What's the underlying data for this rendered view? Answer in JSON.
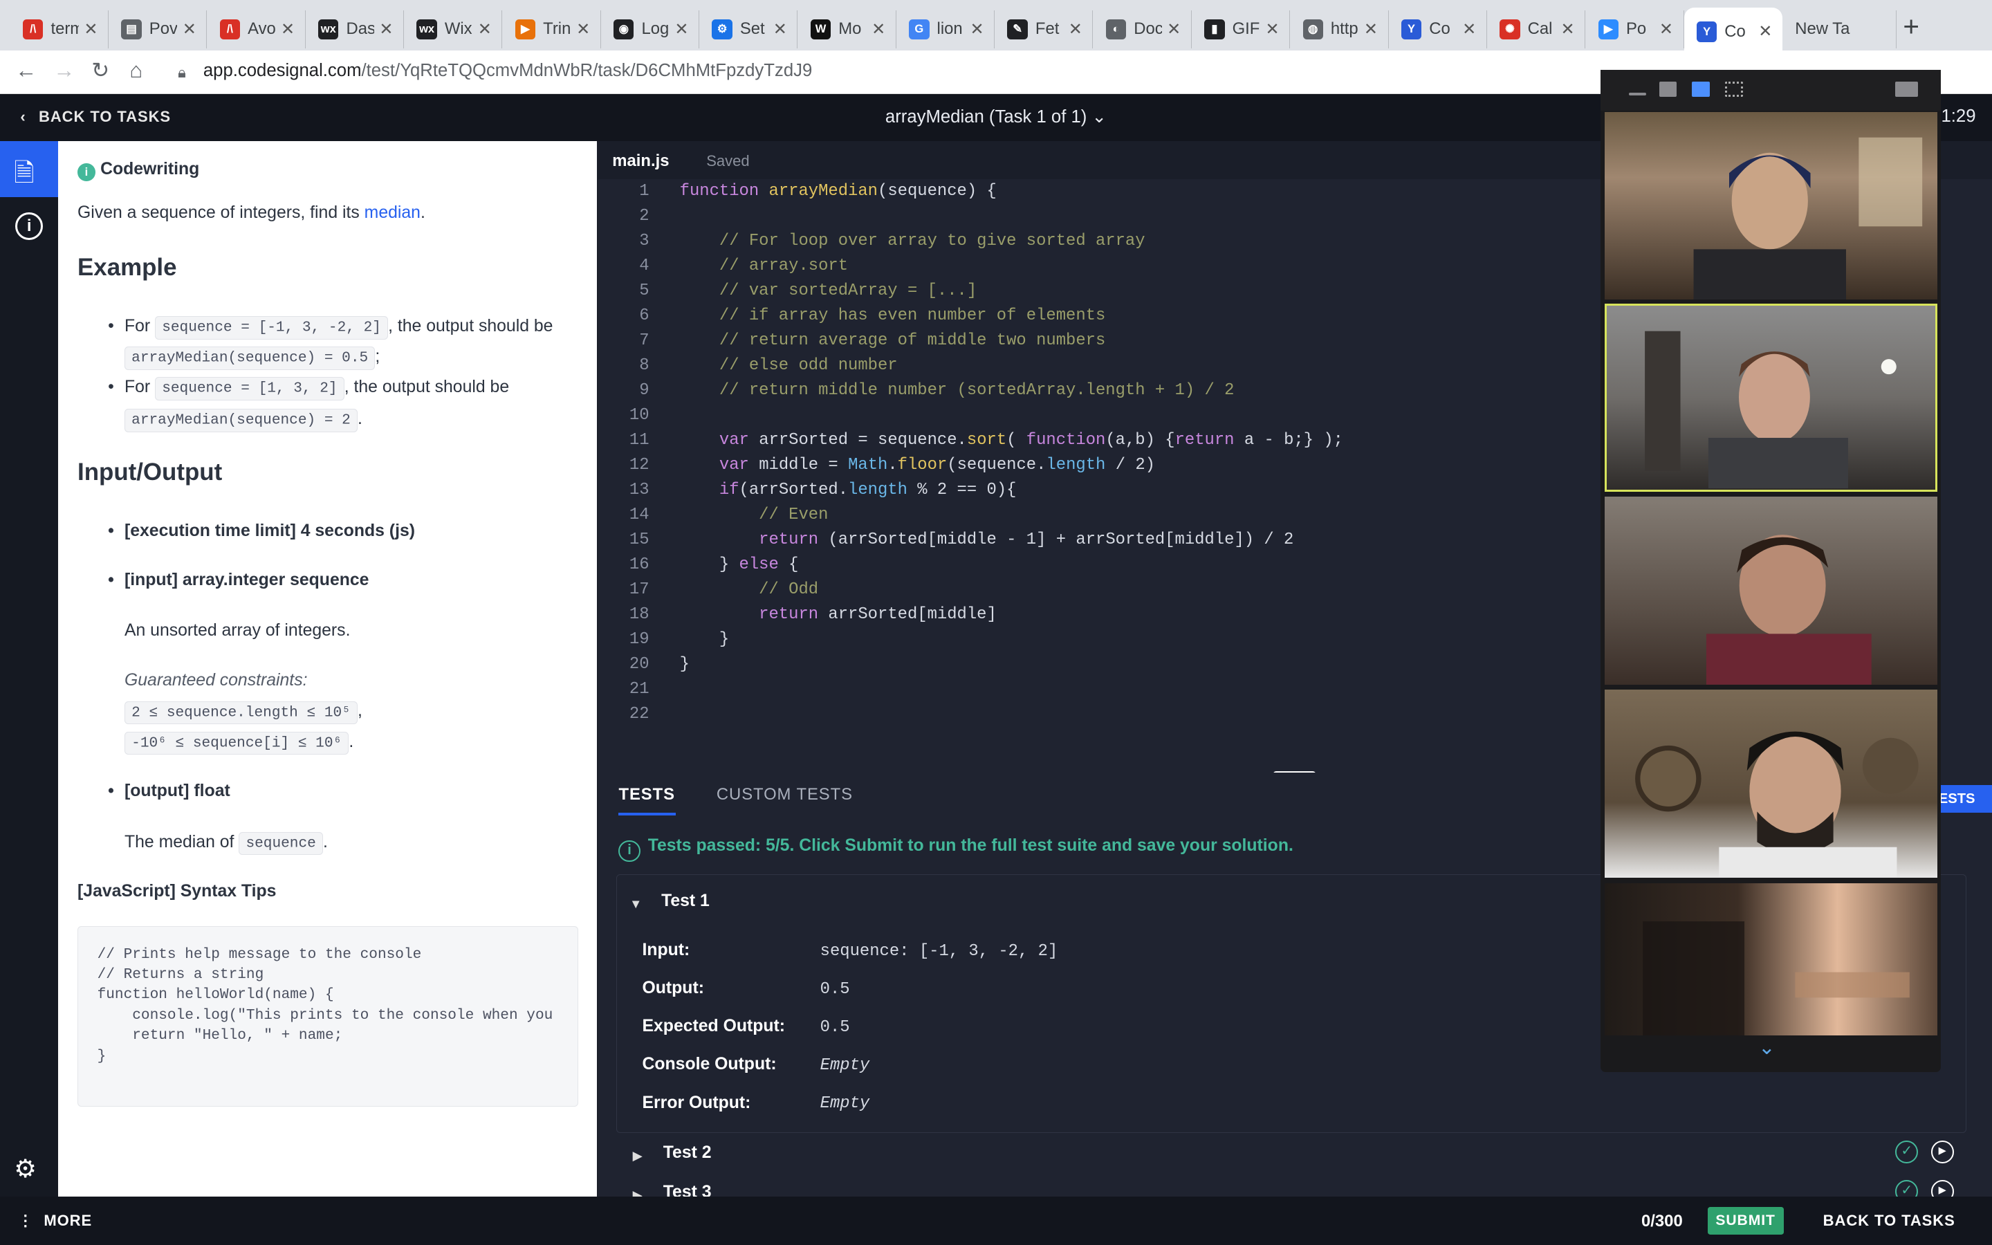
{
  "browser": {
    "tabs": [
      {
        "label": "term",
        "color": "#d93025",
        "glyph": "/\\"
      },
      {
        "label": "Pov",
        "color": "#5f6368",
        "glyph": "▤"
      },
      {
        "label": "Avo",
        "color": "#d93025",
        "glyph": "/\\"
      },
      {
        "label": "Das",
        "color": "#202124",
        "glyph": "wx"
      },
      {
        "label": "Wix",
        "color": "#202124",
        "glyph": "wx"
      },
      {
        "label": "Trin",
        "color": "#e8710a",
        "glyph": "▶"
      },
      {
        "label": "Log",
        "color": "#202124",
        "glyph": "◉"
      },
      {
        "label": "Set",
        "color": "#1a73e8",
        "glyph": "⚙"
      },
      {
        "label": "Mo",
        "color": "#111",
        "glyph": "W"
      },
      {
        "label": "lion",
        "color": "#4285f4",
        "glyph": "G"
      },
      {
        "label": "Fet",
        "color": "#202124",
        "glyph": "✎"
      },
      {
        "label": "Doc",
        "color": "#5f6368",
        "glyph": "◐"
      },
      {
        "label": "GIF",
        "color": "#202124",
        "glyph": "▮"
      },
      {
        "label": "http",
        "color": "#5f6368",
        "glyph": "◍"
      },
      {
        "label": "Co",
        "color": "#2a5bd7",
        "glyph": "Y"
      },
      {
        "label": "Cal",
        "color": "#d93025",
        "glyph": "✺"
      },
      {
        "label": "Po",
        "color": "#2d8cff",
        "glyph": "▶"
      },
      {
        "label": "Co",
        "color": "#2a5bd7",
        "glyph": "Y"
      },
      {
        "label": "New Ta",
        "color": "",
        "glyph": ""
      }
    ],
    "active_tab": 17,
    "url_host": "app.codesignal.com",
    "url_path": "/test/YqRteTQQcmvMdnWbR/task/D6CMhMtFpzdyTzdJ9"
  },
  "header": {
    "back": "BACK TO TASKS",
    "task_title": "arrayMedian (Task 1 of 1) ⌄",
    "timer": "1:29"
  },
  "problem": {
    "badge": "Codewriting",
    "intro": "Given a sequence of integers, find its ",
    "intro_link": "median",
    "intro_end": ".",
    "example_heading": "Example",
    "ex1_pre": "For ",
    "ex1_code": "sequence = [-1, 3, -2, 2]",
    "ex1_mid": ", the output should be",
    "ex1_out": "arrayMedian(sequence) = 0.5",
    "ex1_end": ";",
    "ex2_pre": "For ",
    "ex2_code": "sequence = [1, 3, 2]",
    "ex2_mid": ", the output should be",
    "ex2_out": "arrayMedian(sequence) = 2",
    "ex2_end": ".",
    "io_heading": "Input/Output",
    "exec_limit": "[execution time limit] 4 seconds (js)",
    "input_label": "[input] array.integer sequence",
    "input_desc": "An unsorted array of integers.",
    "constraints_label": "Guaranteed constraints:",
    "constraint1": "2 ≤ sequence.length ≤ 10⁵",
    "constraint1_end": ",",
    "constraint2": "-10⁶ ≤ sequence[i] ≤ 10⁶",
    "constraint2_end": ".",
    "output_label": "[output] float",
    "output_desc_pre": "The median of ",
    "output_desc_code": "sequence",
    "output_desc_end": ".",
    "tips_heading": "[JavaScript] Syntax Tips",
    "tips_code": "// Prints help message to the console\n// Returns a string\nfunction helloWorld(name) {\n    console.log(\"This prints to the console when you\n    return \"Hello, \" + name;\n}"
  },
  "editor": {
    "filename": "main.js",
    "status": "Saved",
    "lines": [
      "function arrayMedian(sequence) {",
      "",
      "    // For loop over array to give sorted array",
      "    // array.sort",
      "    // var sortedArray = [...]",
      "    // if array has even number of elements",
      "    // return average of middle two numbers",
      "    // else odd number",
      "    // return middle number (sortedArray.length + 1) / 2",
      "",
      "    var arrSorted = sequence.sort( function(a,b) {return a - b;} );",
      "    var middle = Math.floor(sequence.length / 2)",
      "    if(arrSorted.length % 2 == 0){",
      "        // Even",
      "        return (arrSorted[middle - 1] + arrSorted[middle]) / 2",
      "    } else {",
      "        // Odd",
      "        return arrSorted[middle]",
      "    }",
      "}",
      "",
      ""
    ]
  },
  "tests": {
    "tab_tests": "TESTS",
    "tab_custom": "CUSTOM TESTS",
    "passed_msg": "Tests passed: 5/5. Click Submit to run the full test suite and save your solution.",
    "test1": "Test 1",
    "input_label": "Input:",
    "input_val": "sequence: [-1, 3, -2, 2]",
    "output_label": "Output:",
    "output_val": "0.5",
    "expected_label": "Expected Output:",
    "expected_val": "0.5",
    "console_label": "Console Output:",
    "console_val": "Empty",
    "error_label": "Error Output:",
    "error_val": "Empty",
    "test2": "Test 2",
    "test3": "Test 3",
    "run_tests_partial": "ESTS"
  },
  "footer": {
    "more": "MORE",
    "score": "0/300",
    "submit": "SUBMIT",
    "back": "BACK TO TASKS"
  },
  "colors": {
    "accent": "#2761ef",
    "success": "#44b89a",
    "submit": "#2fa16d",
    "active_speaker": "#d7e35b"
  }
}
